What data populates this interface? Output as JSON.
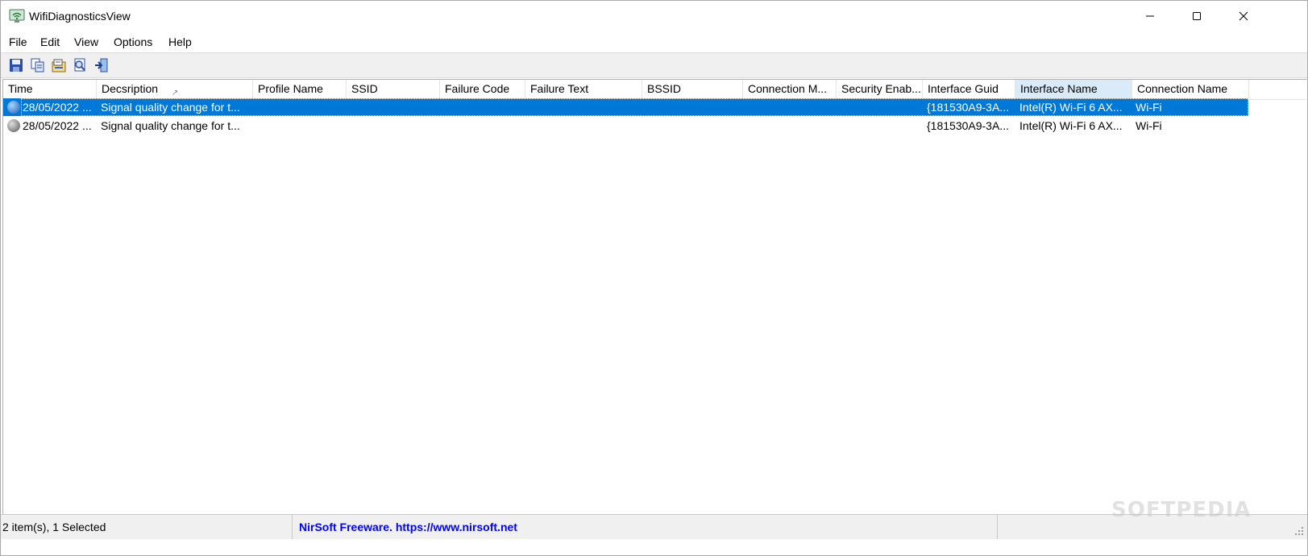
{
  "window": {
    "title": "WifiDiagnosticsView"
  },
  "menu": [
    "File",
    "Edit",
    "View",
    "Options",
    "Help"
  ],
  "toolbar": {
    "buttons": [
      "save-icon",
      "copy-icon",
      "properties-icon",
      "find-icon",
      "exit-icon"
    ]
  },
  "columns": [
    "Time",
    "Decsription",
    "Profile Name",
    "SSID",
    "Failure Code",
    "Failure Text",
    "BSSID",
    "Connection M...",
    "Security Enab...",
    "Interface Guid",
    "Interface Name",
    "Connection Name"
  ],
  "rows": [
    {
      "time": "28/05/2022 ...",
      "description": "Signal quality change for t...",
      "interface_guid": "{181530A9-3A...",
      "interface_name": "Intel(R) Wi-Fi 6 AX...",
      "connection_name": "Wi-Fi",
      "selected": true
    },
    {
      "time": "28/05/2022 ...",
      "description": "Signal quality change for t...",
      "interface_guid": "{181530A9-3A...",
      "interface_name": "Intel(R) Wi-Fi 6 AX...",
      "connection_name": "Wi-Fi",
      "selected": false
    }
  ],
  "status": {
    "items": "2 item(s), 1 Selected",
    "link": "NirSoft Freeware. https://www.nirsoft.net"
  },
  "watermark": "SOFTPEDIA",
  "colors": {
    "selection": "#0078d7",
    "link": "#0000ff",
    "header_highlight": "#d9ebf9"
  }
}
